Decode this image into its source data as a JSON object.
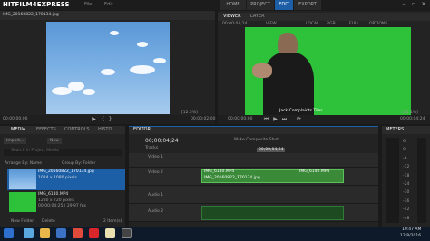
{
  "app": {
    "title": "HITFILM4EXPRESS",
    "menu": [
      "File",
      "Edit"
    ]
  },
  "nav": [
    "HOME",
    "PROJECT",
    "EDIT",
    "EXPORT"
  ],
  "nav_active": "EDIT",
  "trimmer": {
    "filename": "IMG_20160822_170134.jpg",
    "time_start": "00;00;00;00",
    "time_end": "00;00;02;00",
    "zoom": "[12.5%]"
  },
  "viewer": {
    "tabs": [
      "VIEWER",
      "LAYER"
    ],
    "options": [
      "00:00:04;24",
      "VIEW",
      "LOCAL",
      "RGB",
      "FULL",
      "OPTIONS"
    ],
    "time_start": "00;00;00;00",
    "time_end": "00;00;04;24",
    "zoom": "[51.1%]",
    "caption": "Jack Complaints Tiles"
  },
  "media": {
    "tabs": [
      "MEDIA",
      "EFFECTS",
      "CONTROLS",
      "HISTO"
    ],
    "import_label": "Import...",
    "new_label": "New",
    "search_placeholder": "Search in Project Media",
    "arrange_label": "Arrange By: Name",
    "group_label": "Group By: Folder",
    "items": [
      {
        "name": "IMG_20160822_170134.jpg",
        "info": "1024 x 1080 pixels"
      },
      {
        "name": "IMG_6140.MP4",
        "info": "1280 x 720 pixels",
        "extra": "00;00;04;25 | 29.97 fps"
      }
    ],
    "new_folder": "New Folder",
    "delete": "Delete",
    "count": "2 Item(s)"
  },
  "editor": {
    "tab": "EDITOR",
    "timecode": "00;00;04;24",
    "center_label": "Make Composite Shot",
    "playhead_time": "00;00;04;24",
    "tracks_label": "Tracks",
    "tracks": [
      "Video 1",
      "Video 2",
      "Audio 1",
      "Audio 2"
    ],
    "clips": [
      "IMG_6140.MP4",
      "IMG_20160822_170134.jpg",
      "IMG_6140.MP4"
    ]
  },
  "meters": {
    "title": "METERS",
    "scale": [
      "6",
      "0",
      "-6",
      "-12",
      "-18",
      "-24",
      "-30",
      "-36",
      "-42",
      "-48"
    ]
  },
  "taskbar": {
    "time": "10:47 AM",
    "date": "12/8/2016"
  },
  "colors": {
    "accent": "#1d5fa6",
    "green_screen": "#2ec23a",
    "clip": "#3a8a3a"
  }
}
